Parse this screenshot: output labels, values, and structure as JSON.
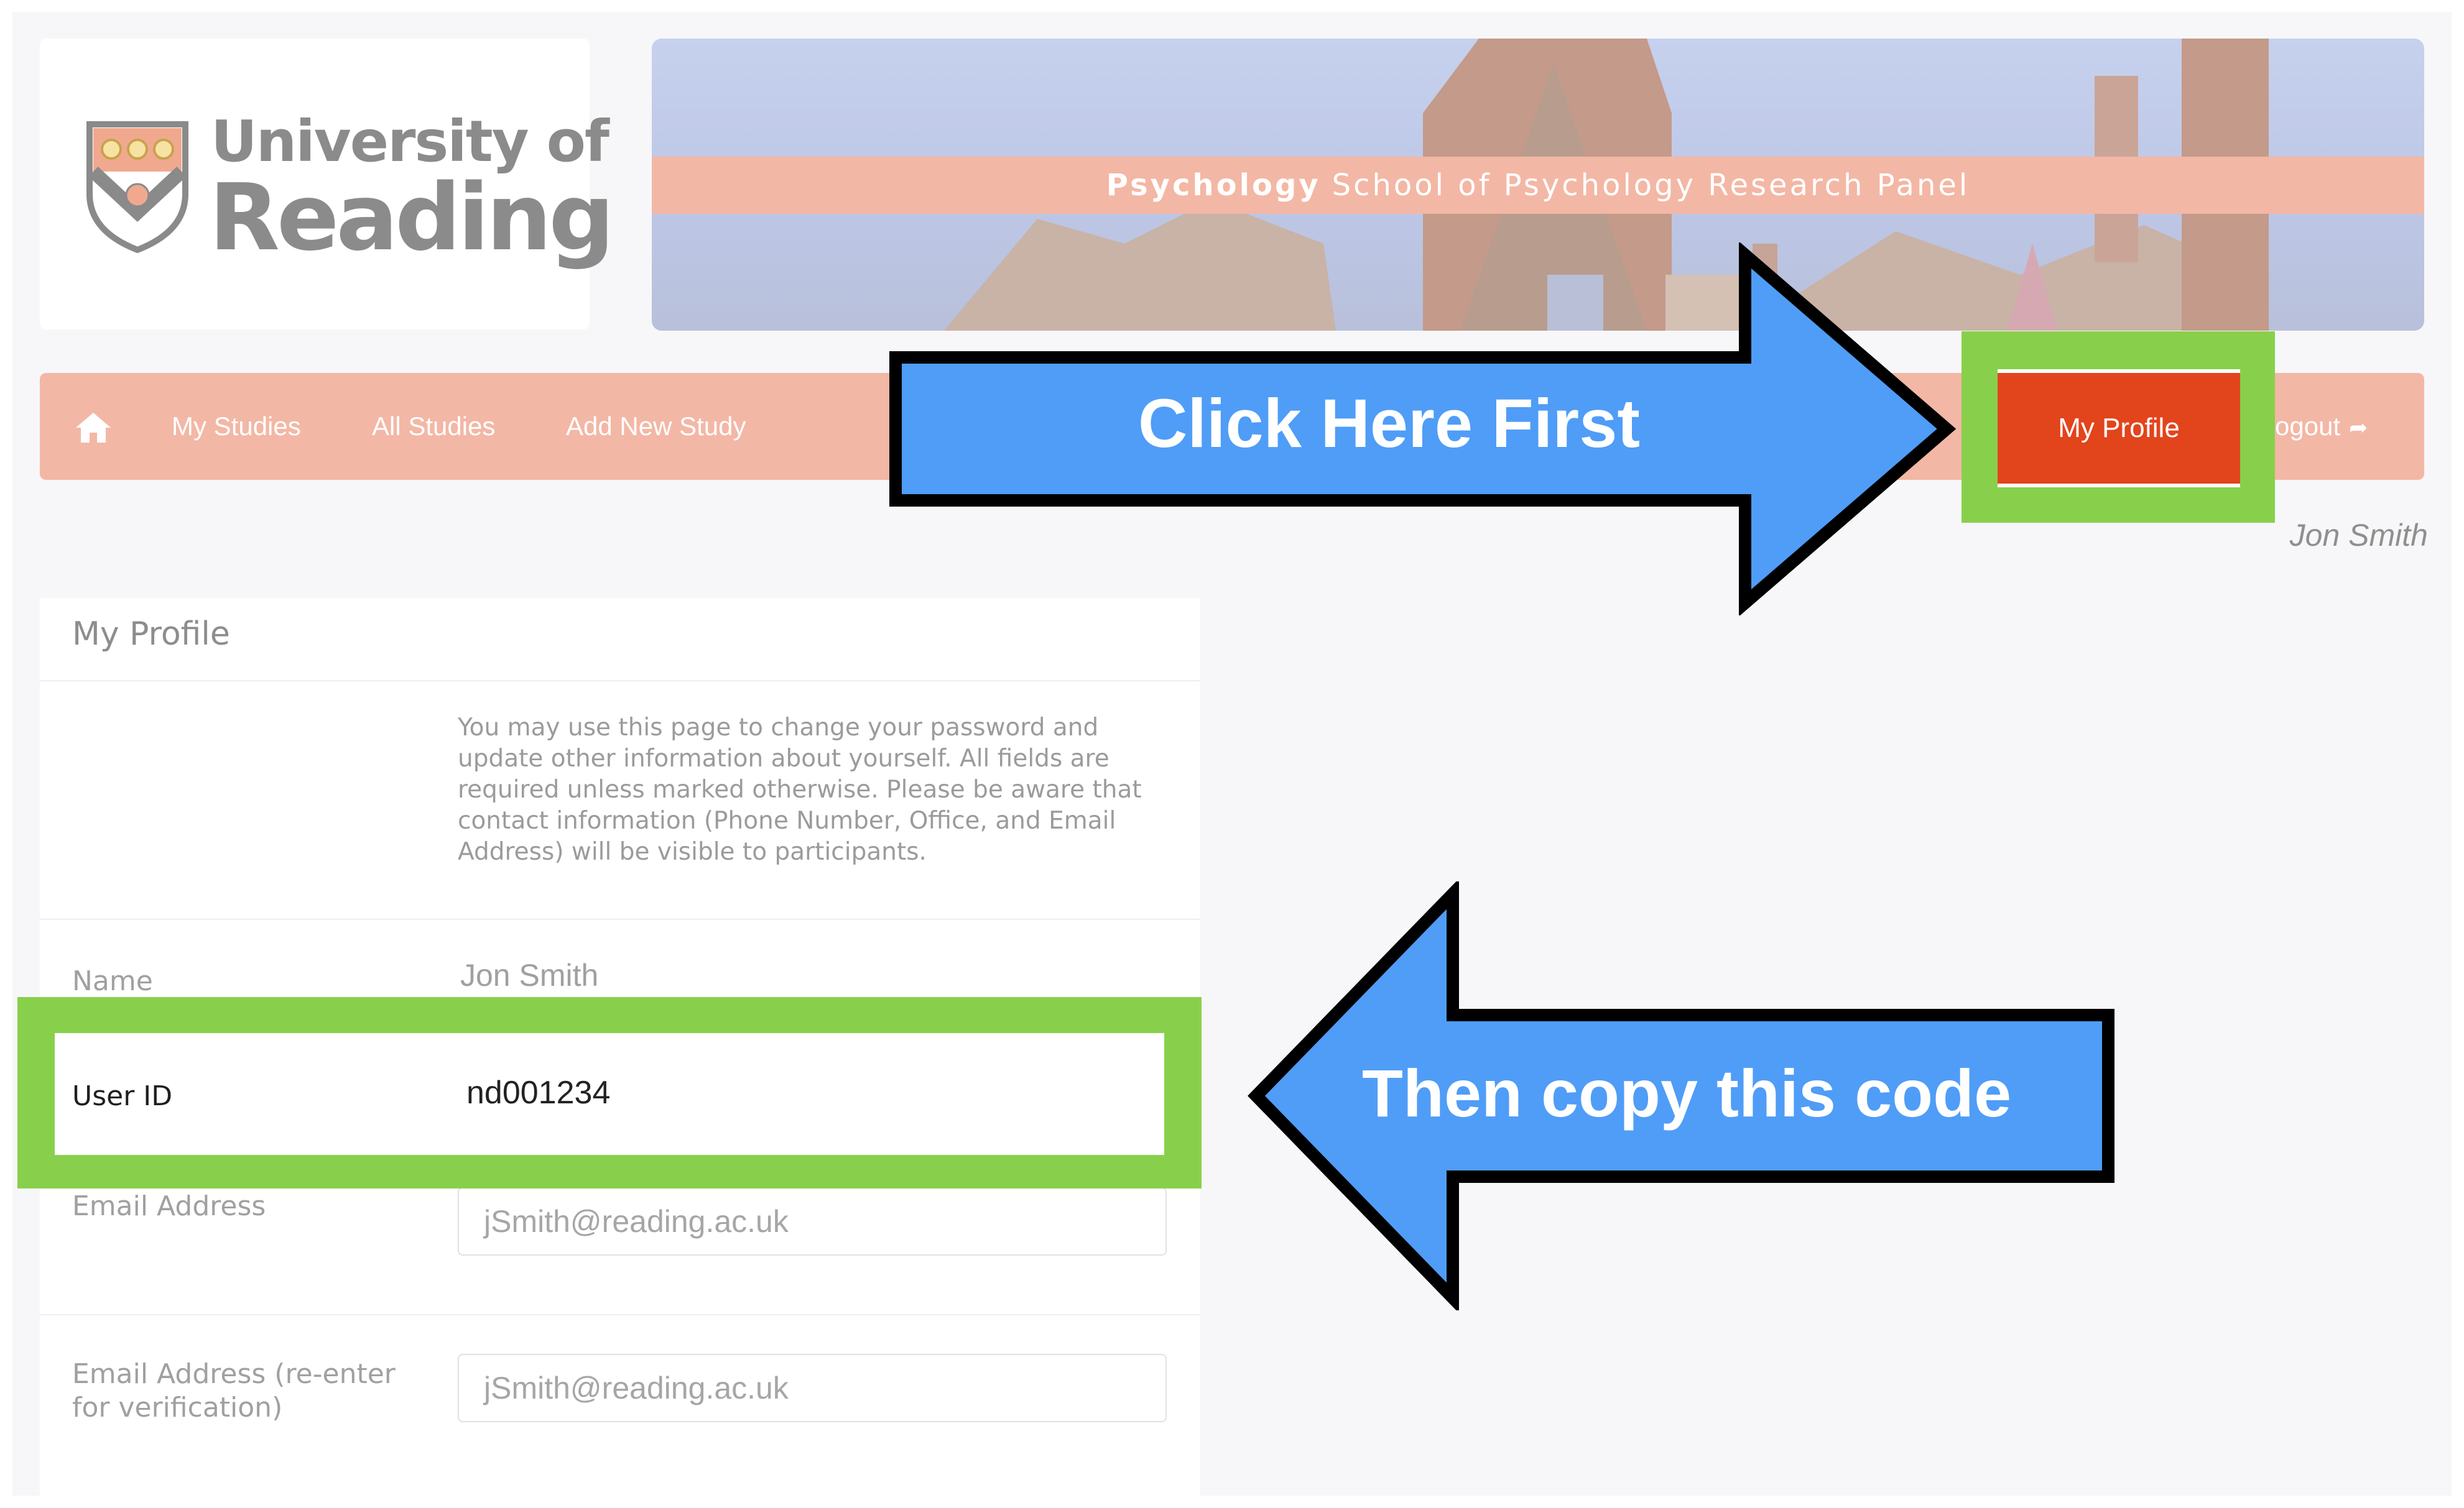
{
  "logo": {
    "line1": "University of",
    "line2": "Reading"
  },
  "banner": {
    "prefix": "Psychology",
    "title": "School of Psychology Research Panel"
  },
  "nav": {
    "home_icon": "home-icon",
    "items": [
      {
        "label": "My Studies"
      },
      {
        "label": "All Studies"
      },
      {
        "label": "Add New Study"
      }
    ],
    "active": "My Profile",
    "logout": "ogout",
    "logout_icon": "sign-out-icon"
  },
  "user_name": "Jon Smith",
  "profile": {
    "title": "My Profile",
    "intro": "You may use this page to change your password and update other information about yourself. All fields are required unless marked otherwise. Please be aware that contact information (Phone Number, Office, and Email Address) will be visible to participants.",
    "name_label": "Name",
    "name_value": "Jon Smith",
    "user_id_label": "User ID",
    "user_id_value": "nd001234",
    "email_label": "Email Address",
    "email_value": "jSmith@reading.ac.uk",
    "email_confirm_label": "Email Address (re-enter for verification)",
    "email_confirm_value": "jSmith@reading.ac.uk"
  },
  "annotations": {
    "first": "Click Here First",
    "second": "Then copy this code",
    "arrow_color": "#4f9df7",
    "highlight_color": "#88d04b"
  },
  "colors": {
    "nav_bg": "#f3b7a5",
    "active_button": "#e2441c"
  }
}
